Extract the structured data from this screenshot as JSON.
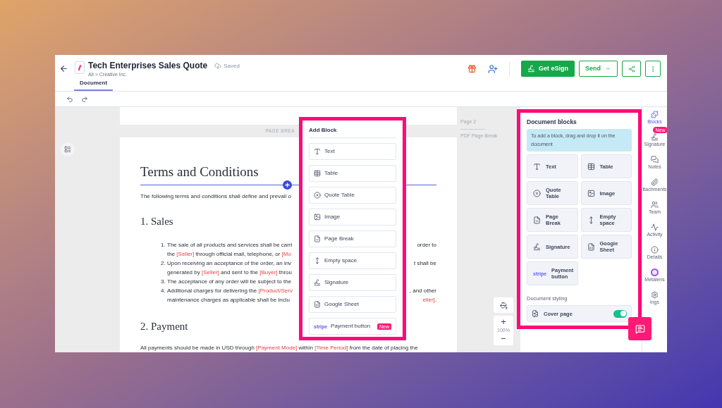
{
  "header": {
    "title": "Tech Enterprises Sales Quote",
    "status": "Saved",
    "breadcrumb": "All > Creative Inc.",
    "tabs": [
      {
        "label": "Document",
        "selected": true
      }
    ],
    "esign_button": "Get eSign",
    "send_button": "Send"
  },
  "document": {
    "page_break_label": "PAGE BREA",
    "heading": "Terms and Conditions",
    "intro": "The following terms and conditions shall define and prevail o",
    "sections": [
      {
        "heading": "1. Sales",
        "items": [
          {
            "number": "1.",
            "lines": [
              {
                "left": [
                  {
                    "text": "The sale of all products and services shall be carri",
                    "kind": "plain"
                  }
                ],
                "right": [
                  {
                    "text": "order to",
                    "kind": "plain"
                  }
                ]
              },
              {
                "left": [
                  {
                    "text": "the ",
                    "kind": "plain"
                  },
                  {
                    "text": "[Seller]",
                    "kind": "field"
                  },
                  {
                    "text": " through official mail, telephone, or ",
                    "kind": "plain"
                  },
                  {
                    "text": "[Mo",
                    "kind": "field"
                  }
                ]
              }
            ]
          },
          {
            "number": "2.",
            "lines": [
              {
                "left": [
                  {
                    "text": "Upon receiving an acceptance of the order, an inv",
                    "kind": "plain"
                  }
                ],
                "right": [
                  {
                    "text": "t shall be",
                    "kind": "plain"
                  }
                ]
              },
              {
                "left": [
                  {
                    "text": "generated by ",
                    "kind": "plain"
                  },
                  {
                    "text": "[Seller]",
                    "kind": "field"
                  },
                  {
                    "text": " and sent to the ",
                    "kind": "plain"
                  },
                  {
                    "text": "[Buyer]",
                    "kind": "field"
                  },
                  {
                    "text": " throu",
                    "kind": "plain"
                  }
                ]
              }
            ]
          },
          {
            "number": "3.",
            "lines": [
              {
                "left": [
                  {
                    "text": "The acceptance of any order will be subject to the",
                    "kind": "plain"
                  }
                ]
              }
            ]
          },
          {
            "number": "4.",
            "lines": [
              {
                "left": [
                  {
                    "text": "Additional charges for delivering the ",
                    "kind": "plain"
                  },
                  {
                    "text": "[Product/Serv",
                    "kind": "field"
                  }
                ],
                "right": [
                  {
                    "text": ", and other",
                    "kind": "plain"
                  }
                ]
              },
              {
                "left": [
                  {
                    "text": "maintenance charges as applicable shall be inclu",
                    "kind": "plain"
                  }
                ],
                "right": [
                  {
                    "text": "eller]",
                    "kind": "field"
                  },
                  {
                    "text": ".",
                    "kind": "plain"
                  }
                ]
              }
            ]
          }
        ]
      },
      {
        "heading": "2. Payment",
        "paragraph": [
          {
            "text": "All payments should be made in USD through ",
            "kind": "plain"
          },
          {
            "text": "[Payment Mode]",
            "kind": "field"
          },
          {
            "text": " within ",
            "kind": "plain"
          },
          {
            "text": "[Time Period]",
            "kind": "field"
          },
          {
            "text": " from the date of placing the",
            "kind": "plain"
          }
        ]
      }
    ]
  },
  "page_notes": [
    "Page 2",
    "---------------",
    "PDF Page Break"
  ],
  "zoom": {
    "level_text": "100%",
    "plus": "+",
    "minus": "−"
  },
  "add_block": {
    "title": "Add Block",
    "items": [
      {
        "label": "Text"
      },
      {
        "label": "Table"
      },
      {
        "label": "Quote Table"
      },
      {
        "label": "Image"
      },
      {
        "label": "Page Break"
      },
      {
        "label": "Empty space"
      },
      {
        "label": "Signature"
      },
      {
        "label": "Google Sheet"
      },
      {
        "label": "Payment button",
        "logo": "stripe",
        "badge": "New"
      }
    ]
  },
  "document_blocks": {
    "title": "Document blocks",
    "hint": "To add a block, drag and drop it on the document",
    "items": [
      {
        "label": "Text"
      },
      {
        "label": "Table"
      },
      {
        "label": "Quote Table"
      },
      {
        "label": "Image"
      },
      {
        "label": "Page Break"
      },
      {
        "label": "Empty space"
      },
      {
        "label": "Signature"
      },
      {
        "label": "Google Sheet"
      },
      {
        "label": "Payment button",
        "logo": "stripe"
      }
    ],
    "styling_label": "Document styling",
    "cover_page": {
      "label": "Cover page",
      "on": true
    }
  },
  "rail": [
    {
      "label": "Blocks",
      "selected": true
    },
    {
      "label": "Signature",
      "selected": false,
      "badge": "New"
    },
    {
      "label": "Notes",
      "selected": false
    },
    {
      "label": "ttachments",
      "selected": false
    },
    {
      "label": "Team",
      "selected": false
    },
    {
      "label": "Activity",
      "selected": false
    },
    {
      "label": "Details",
      "selected": false
    },
    {
      "label": "Metalens",
      "selected": false
    },
    {
      "label": "ings",
      "selected": false
    }
  ]
}
